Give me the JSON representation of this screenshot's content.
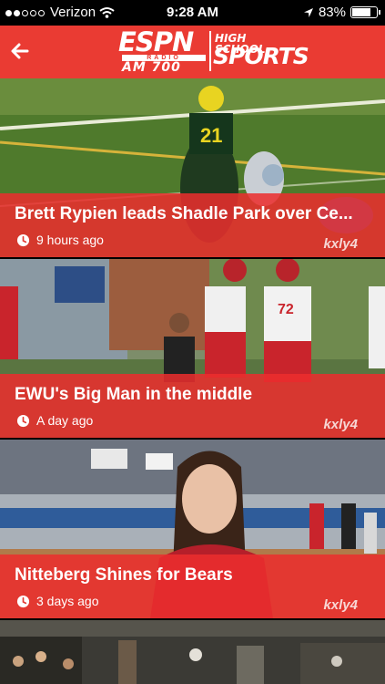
{
  "status": {
    "carrier": "Verizon",
    "time": "9:28 AM",
    "battery_text": "83%",
    "battery_level": 0.83,
    "signal_bars": 2,
    "signal_total": 5
  },
  "header": {
    "logo": {
      "espn": "ESPN",
      "radio": "RADIO",
      "station": "AM 700",
      "high_school": "HIGH SCHOOL",
      "sports": "SPORTS"
    },
    "brand_color": "#ea3b33"
  },
  "stories": [
    {
      "headline": "Brett Rypien leads Shadle Park over Ce...",
      "time": "9 hours ago",
      "watermark": "kxly4"
    },
    {
      "headline": "EWU's Big Man in the middle",
      "time": "A day ago",
      "watermark": "kxly4"
    },
    {
      "headline": "Nitteberg Shines for Bears",
      "time": "3 days ago",
      "watermark": "kxly4"
    }
  ],
  "icons": {
    "back": "left-arrow-icon",
    "clock": "clock-icon",
    "wifi": "wifi-icon",
    "location": "location-arrow-icon",
    "battery": "battery-icon"
  }
}
